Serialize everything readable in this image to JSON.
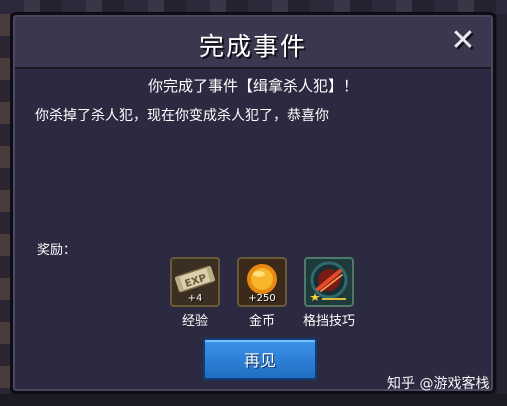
{
  "dialog": {
    "title": "完成事件",
    "close_glyph": "✕",
    "event_line": "你完成了事件【缉拿杀人犯】！",
    "description": "你杀掉了杀人犯，现在你变成杀人犯了，恭喜你",
    "rewards_label": "奖励："
  },
  "rewards": [
    {
      "icon": "exp-scroll-icon",
      "amount": "+4",
      "name": "经验"
    },
    {
      "icon": "gold-coin-icon",
      "amount": "+250",
      "name": "金币"
    },
    {
      "icon": "parry-skill-icon",
      "amount": "",
      "name": "格挡技巧"
    }
  ],
  "exp_icon_text": "EXP",
  "ok_button": "再见",
  "watermark": "知乎 @游戏客栈"
}
